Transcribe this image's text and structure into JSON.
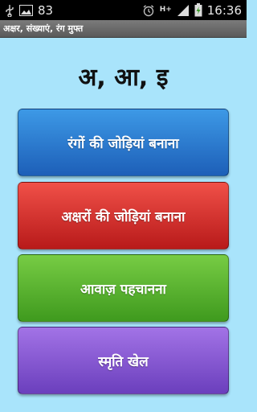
{
  "status_bar": {
    "left_count": "83",
    "network_label": "H+",
    "time": "16:36",
    "icons": [
      "usb-icon",
      "image-icon",
      "alarm-icon",
      "network-h-plus-icon",
      "signal-icon",
      "battery-charging-icon"
    ]
  },
  "title_bar": {
    "title": "अक्षर, संख्याएं, रंग मुफ्त"
  },
  "main": {
    "heading": "अ, आ, इ",
    "buttons": [
      {
        "label": "रंगों की जोड़ियां बनाना",
        "color": "#2f7fd6"
      },
      {
        "label": "अक्षरों की जोड़ियां बनाना",
        "color": "#d93030"
      },
      {
        "label": "आवाज़ पहचानना",
        "color": "#5cb335"
      },
      {
        "label": "स्मृति खेल",
        "color": "#8a5ad6"
      }
    ]
  },
  "colors": {
    "background": "#a9e4fb",
    "status_bar": "#000000",
    "title_bar": "#6a6a6a"
  }
}
